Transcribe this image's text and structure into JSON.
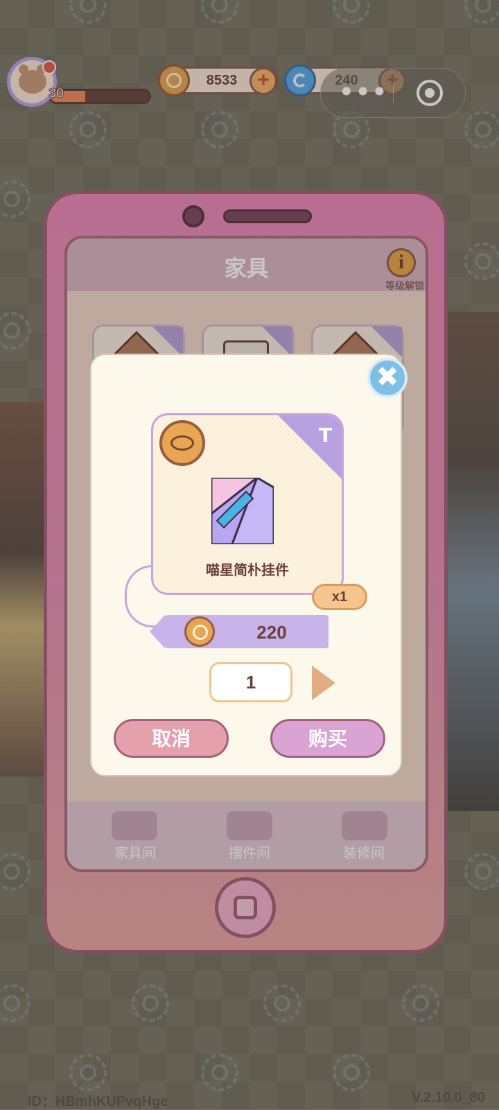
{
  "hud": {
    "level": "30",
    "level_progress": 0.35,
    "coins": "8533",
    "gems": "240",
    "coin_icon": "coin-icon",
    "gem_icon": "swirl-icon",
    "plus_label": "+"
  },
  "capsule": {
    "more_label": "•••",
    "target_icon": "target-icon"
  },
  "screen": {
    "title": "家具",
    "info_icon_label": "i",
    "info_label": "等级解锁",
    "tabs": [
      {
        "label": "家具间",
        "icon": "sofa-icon"
      },
      {
        "label": "摆件间",
        "icon": "cup-icon"
      },
      {
        "label": "装修间",
        "icon": "tile-icon"
      }
    ]
  },
  "modal": {
    "close_label": "✖",
    "item_name": "喵星简朴挂件",
    "quantity_badge": "x1",
    "price": "220",
    "buy_quantity": "1",
    "cancel_label": "取消",
    "buy_label": "购买",
    "corner_mark": "T"
  },
  "footer": {
    "id_text": "ID：HBmhKUPvqHge",
    "version": "V.2.10.0_80"
  },
  "colors": {
    "phone_pink": "#e989b6",
    "accent_purple": "#b8a1e0",
    "text_brown": "#6b3f3a"
  }
}
